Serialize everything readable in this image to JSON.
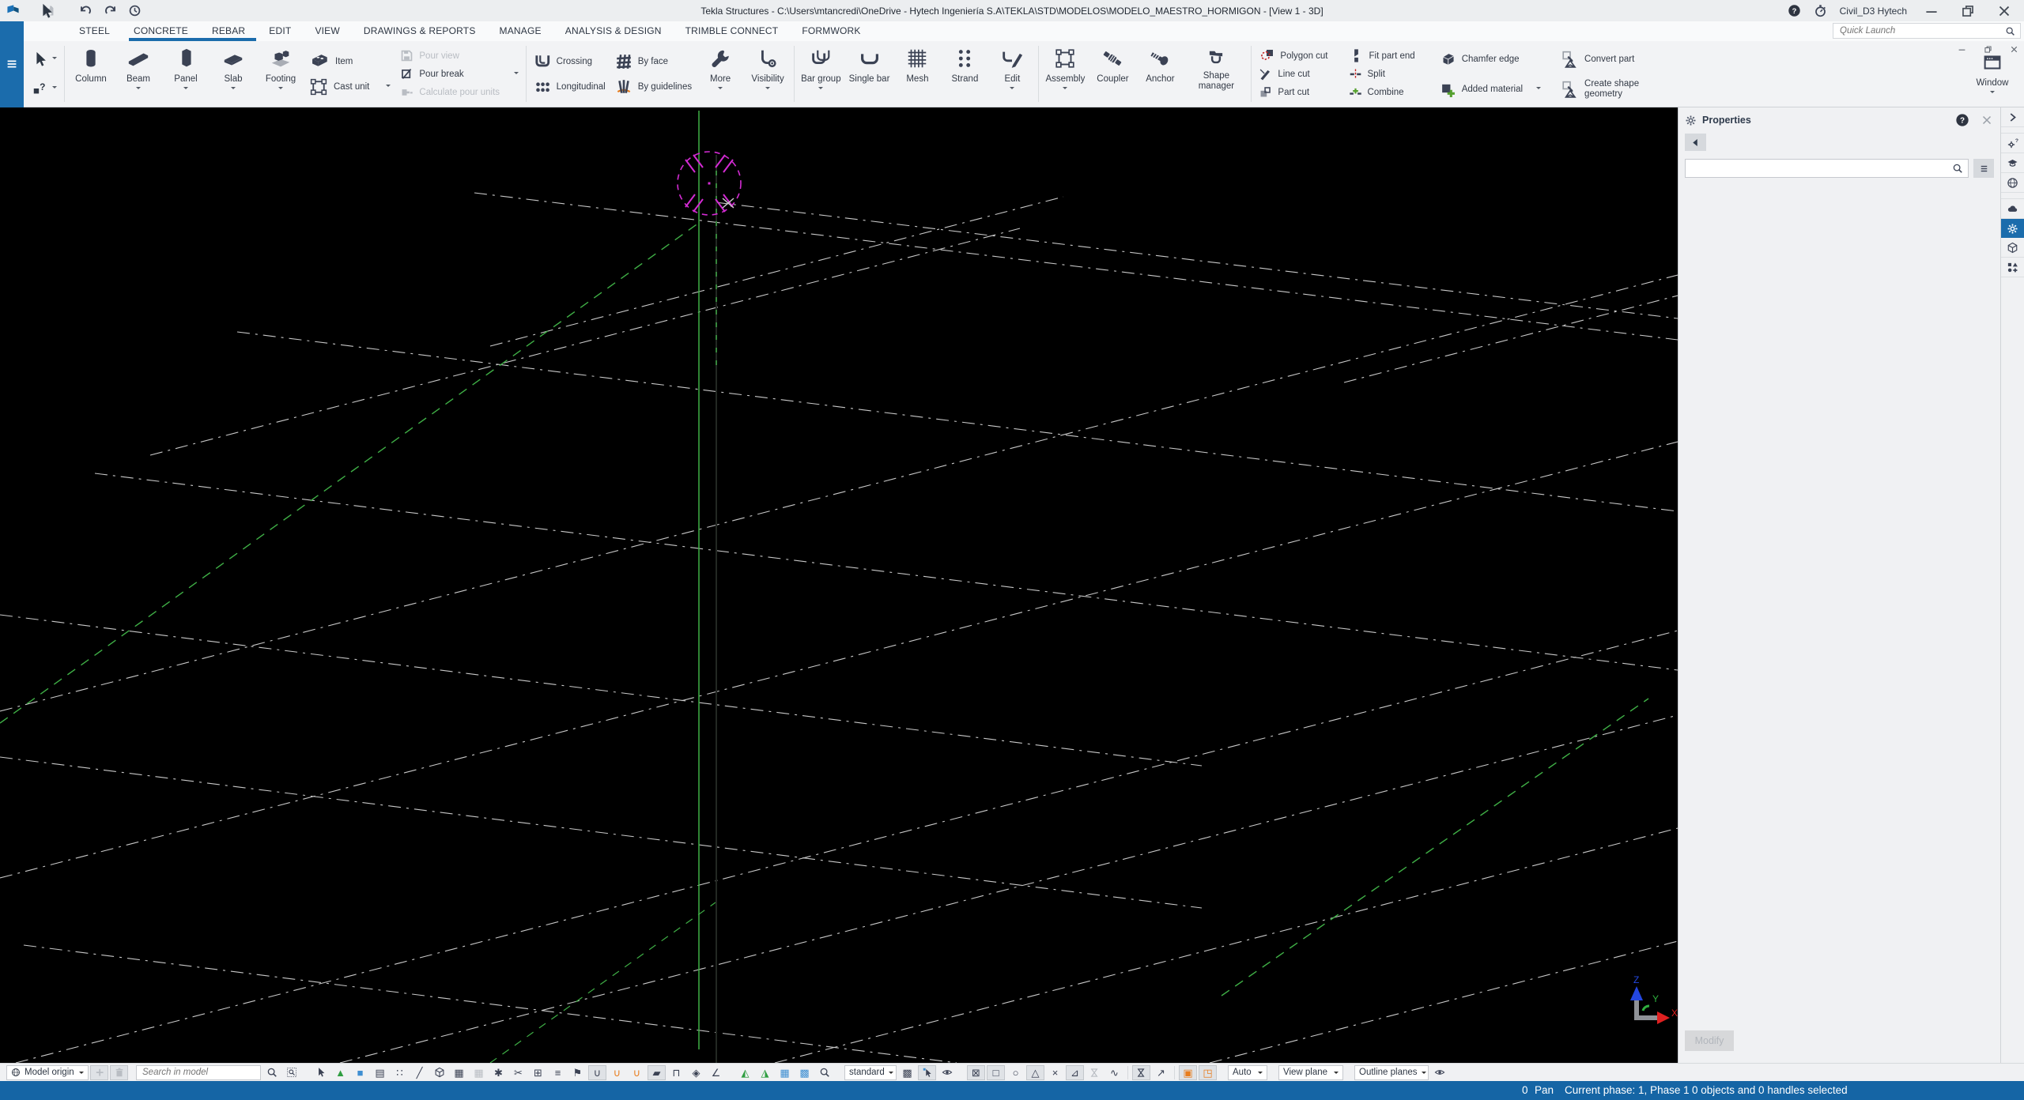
{
  "window": {
    "title": "Tekla Structures - C:\\Users\\mtancredi\\OneDrive - Hytech Ingeniería S.A\\TEKLA\\STD\\MODELOS\\MODELO_MAESTRO_HORMIGON  - [View 1 - 3D]",
    "account": "Civil_D3 Hytech",
    "quick_launch_placeholder": "Quick Launch"
  },
  "tabs": [
    {
      "label": "STEEL"
    },
    {
      "label": "CONCRETE",
      "active": true
    },
    {
      "label": "REBAR",
      "active": true
    },
    {
      "label": "EDIT"
    },
    {
      "label": "VIEW"
    },
    {
      "label": "DRAWINGS & REPORTS"
    },
    {
      "label": "MANAGE"
    },
    {
      "label": "ANALYSIS & DESIGN"
    },
    {
      "label": "TRIMBLE CONNECT"
    },
    {
      "label": "FORMWORK"
    }
  ],
  "ribbon": {
    "column": "Column",
    "beam": "Beam",
    "panel": "Panel",
    "slab": "Slab",
    "footing": "Footing",
    "item": "Item",
    "cast_unit": "Cast unit",
    "pour_view": "Pour view",
    "pour_break": "Pour break",
    "calculate_pour_units": "Calculate pour units",
    "crossing": "Crossing",
    "longitudinal": "Longitudinal",
    "by_face": "By face",
    "by_guidelines": "By guidelines",
    "more": "More",
    "visibility": "Visibility",
    "bar_group": "Bar group",
    "single_bar": "Single bar",
    "mesh": "Mesh",
    "strand": "Strand",
    "edit": "Edit",
    "assembly": "Assembly",
    "coupler": "Coupler",
    "anchor": "Anchor",
    "shape_manager": "Shape manager",
    "polygon_cut": "Polygon cut",
    "line_cut": "Line cut",
    "part_cut": "Part cut",
    "fit_part_end": "Fit part end",
    "split": "Split",
    "combine": "Combine",
    "chamfer_edge": "Chamfer edge",
    "added_material": "Added material",
    "convert_part": "Convert part",
    "create_shape_geometry": "Create shape geometry",
    "window_label": "Window"
  },
  "properties": {
    "title": "Properties",
    "modify": "Modify"
  },
  "bottombar": {
    "model_origin": "Model origin",
    "search_placeholder": "Search in model",
    "rebar_view": "standard",
    "snap_auto": "Auto",
    "work_plane": "View plane",
    "outline": "Outline planes"
  },
  "statusbar": {
    "pan_value": "0",
    "pan_label": "Pan",
    "phase": "Current phase: 1, Phase 1",
    "selection": "0 objects and 0 handles selected"
  },
  "viewport": {
    "axis_x": "X",
    "axis_y": "Y",
    "axis_z": "Z"
  },
  "colors": {
    "accent_blue": "#1b6cac",
    "status_bar_blue": "#1565a5",
    "ribbon_icon_navy": "#3b4254",
    "viewport_green": "#3faf46",
    "marker_magenta": "#d42bd4",
    "highlight_orange": "#e87d1e"
  }
}
